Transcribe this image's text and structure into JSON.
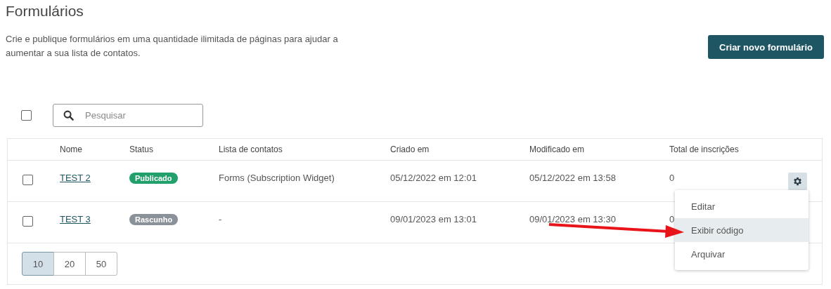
{
  "page": {
    "title": "Formulários",
    "description": "Crie e publique formulários em uma quantidade ilimitada de páginas para ajudar a aumentar a sua lista de contatos.",
    "create_button": "Criar novo formulário"
  },
  "toolbar": {
    "select_all": {
      "checked": false
    },
    "search": {
      "placeholder": "Pesquisar"
    }
  },
  "table": {
    "columns": [
      "Nome",
      "Status",
      "Lista de contatos",
      "Criado em",
      "Modificado em",
      "Total de inscrições"
    ],
    "rows": [
      {
        "checked": false,
        "name": "TEST 2",
        "status": {
          "label": "Publicado",
          "kind": "published"
        },
        "list": "Forms (Subscription Widget)",
        "created": "05/12/2022 em 12:01",
        "modified": "05/12/2022 em 13:58",
        "total": "0",
        "menu_open": true
      },
      {
        "checked": false,
        "name": "TEST 3",
        "status": {
          "label": "Rascunho",
          "kind": "draft"
        },
        "list": "-",
        "created": "09/01/2023 em 13:01",
        "modified": "09/01/2023 em 13:30",
        "total": "0",
        "menu_open": false
      }
    ]
  },
  "page_sizes": [
    {
      "label": "10",
      "selected": true
    },
    {
      "label": "20",
      "selected": false
    },
    {
      "label": "50",
      "selected": false
    }
  ],
  "menu": {
    "items": [
      {
        "label": "Editar",
        "selected": false
      },
      {
        "label": "Exibir código",
        "selected": true
      },
      {
        "label": "Arquivar",
        "selected": false
      }
    ]
  }
}
